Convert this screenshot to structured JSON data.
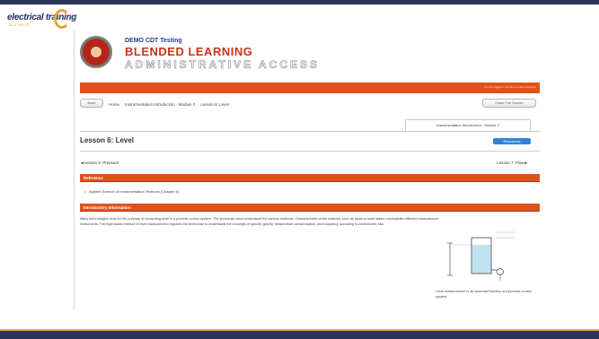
{
  "brand": {
    "name": "electrical training",
    "sub": "ALLIANCE"
  },
  "header": {
    "subtitle": "DEMO CDT Testing",
    "title": "BLENDED LEARNING",
    "admin": "ADMINISTRATIVE ACCESS"
  },
  "banner": {
    "text": "You are logged in as Demo Learner Engage"
  },
  "nav": {
    "back_label": "Back",
    "breadcrumbs": [
      "Home",
      "Instrumentation Introduction - Module 2",
      "Lesson 6: Level"
    ],
    "fullscreen_label": "Close Full Screen"
  },
  "tab": {
    "label": "Instrumentation Introduction - Module 2"
  },
  "lesson": {
    "title": "Lesson 6: Level",
    "resources_label": "Resources",
    "prev_label": "◄Lesson 5: Pressure",
    "next_label": "Lesson 7: Flow►"
  },
  "reference": {
    "heading": "Reference",
    "item": "Applied Science of Instrumentation Textbook (Chapter 6)"
  },
  "introductory": {
    "heading": "Introductory Information",
    "body": "Many technologies exist for the purpose of measuring level in a process control system. The technician must understand the various methods. Characteristics of the material, such as liquid or solid states, necessitate different measurement instruments. The hydrostatic method of level measurement requires the technician to understand the concepts of specific gravity, temperature compensation, and buoyancy according to Archimedes' law.",
    "figure_caption": "Level measurement is an essential function of a process control system."
  },
  "colors": {
    "navy": "#2a3358",
    "orange": "#e0521c",
    "accent_gold": "#e8a33a",
    "resources_blue": "#2f86d6"
  }
}
